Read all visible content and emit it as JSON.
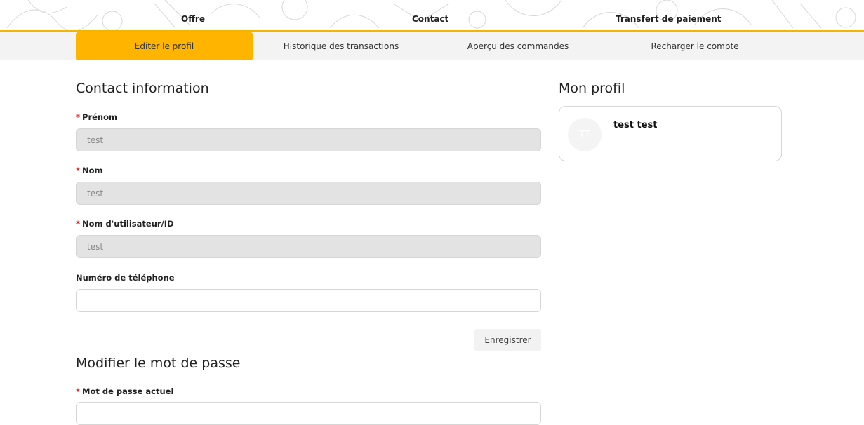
{
  "topnav": {
    "links": [
      "Offre",
      "Contact",
      "Transfert de paiement"
    ],
    "accent": "#f5b400"
  },
  "subnav": {
    "tabs": [
      {
        "label": "Editer le profil",
        "active": true
      },
      {
        "label": "Historique des transactions",
        "active": false
      },
      {
        "label": "Aperçu des commandes",
        "active": false
      },
      {
        "label": "Recharger le compte",
        "active": false
      }
    ],
    "active_color": "#ffb400"
  },
  "contact": {
    "title": "Contact information",
    "fields": [
      {
        "label": "Prénom",
        "required": true,
        "value": "test",
        "disabled": true
      },
      {
        "label": "Nom",
        "required": true,
        "value": "test",
        "disabled": true
      },
      {
        "label": "Nom d'utilisateur/ID",
        "required": true,
        "value": "test",
        "disabled": true
      },
      {
        "label": "Numéro de téléphone",
        "required": false,
        "value": "",
        "disabled": false
      }
    ],
    "save_label": "Enregistrer"
  },
  "password": {
    "title": "Modifier le mot de passe",
    "fields": [
      {
        "label": "Mot de passe actuel",
        "required": true,
        "value": ""
      }
    ]
  },
  "profile": {
    "title": "Mon profil",
    "avatar_initials": "TT",
    "name": "test test"
  }
}
